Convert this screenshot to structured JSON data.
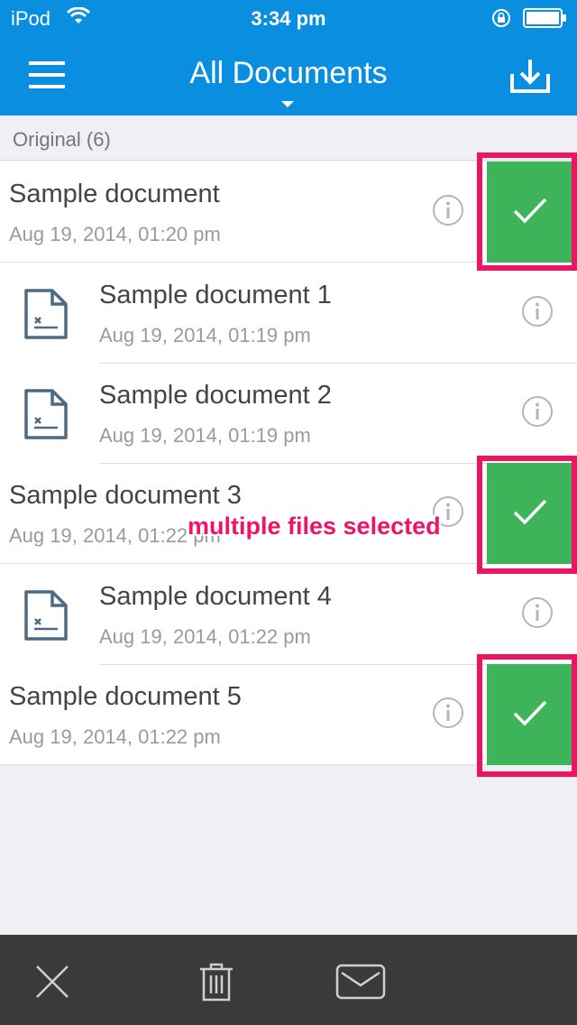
{
  "status_bar": {
    "carrier": "iPod",
    "time": "3:34 pm"
  },
  "nav": {
    "title": "All Documents"
  },
  "section": {
    "header": "Original (6)"
  },
  "documents": [
    {
      "name": "Sample document",
      "date": "Aug 19, 2014, 01:20 pm",
      "level": "parent",
      "selected": true
    },
    {
      "name": "Sample document 1",
      "date": "Aug 19, 2014, 01:19 pm",
      "level": "child",
      "selected": false
    },
    {
      "name": "Sample document 2",
      "date": "Aug 19, 2014, 01:19 pm",
      "level": "child",
      "selected": false
    },
    {
      "name": "Sample document 3",
      "date": "Aug 19, 2014, 01:22 pm",
      "level": "parent",
      "selected": true
    },
    {
      "name": "Sample document 4",
      "date": "Aug 19, 2014, 01:22 pm",
      "level": "child",
      "selected": false
    },
    {
      "name": "Sample document 5",
      "date": "Aug 19, 2014, 01:22 pm",
      "level": "parent",
      "selected": true
    }
  ],
  "annotation": "multiple files selected",
  "toolbar": {
    "icons": [
      "close-icon",
      "trash-icon",
      "mail-icon"
    ]
  },
  "colors": {
    "nav_blue": "#0a8fe0",
    "selected_green": "#3db45a",
    "highlight_pink": "#ec1463",
    "toolbar_dark": "#3a3a3a"
  }
}
